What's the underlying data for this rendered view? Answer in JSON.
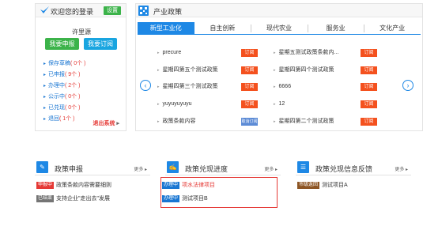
{
  "login": {
    "welcome": "欢迎您的登录",
    "settings": "设置",
    "username": "许里源",
    "subscribe": "我要申报",
    "my_subscribe": "我要订阅",
    "items": [
      {
        "label": "保存草稿",
        "count": "( 0个 )"
      },
      {
        "label": "已申报",
        "count": "( 9个 )"
      },
      {
        "label": "办理中",
        "count": "( 2个 )"
      },
      {
        "label": "公示中",
        "count": "( 0个 )"
      },
      {
        "label": "已兑现",
        "count": "( 0个 )"
      },
      {
        "label": "退回",
        "count": "( 1个 )"
      }
    ],
    "logout": "退出系统"
  },
  "policy": {
    "title": "产业政策",
    "tabs": [
      "新型工业化",
      "自主创新",
      "现代农业",
      "服务业",
      "文化产业"
    ],
    "rows_left": [
      {
        "text": "precure",
        "btn": "订阅"
      },
      {
        "text": "星期四第五个测试政策",
        "btn": "订阅"
      },
      {
        "text": "星期四第三个测试政策",
        "btn": "订阅"
      },
      {
        "text": "yuyuyuyuyu",
        "btn": "订阅"
      },
      {
        "text": "政策条款内容",
        "btn": "取消订阅"
      }
    ],
    "rows_right": [
      {
        "text": "星期五测试政策条款内...",
        "btn": "订阅"
      },
      {
        "text": "星期四第四个测试政策",
        "btn": "订阅"
      },
      {
        "text": "6666",
        "btn": "订阅"
      },
      {
        "text": "12",
        "btn": "订阅"
      },
      {
        "text": "星期四第二个测试政策",
        "btn": "订阅"
      }
    ]
  },
  "declare": {
    "title": "政策申报",
    "more": "更多 ▸",
    "items": [
      {
        "badge": "申报中",
        "text": "政策条款内容需要细则"
      },
      {
        "badge": "已结束",
        "text": "支持企业\"走出去\"发展"
      }
    ]
  },
  "progress": {
    "title": "政策兑现进度",
    "more": "更多 ▸",
    "items": [
      {
        "badge": "办理中",
        "text": "项水法律项目"
      },
      {
        "badge": "办理中",
        "text": "测试项目B"
      }
    ]
  },
  "feedback": {
    "title": "政策兑现信息反馈",
    "more": "更多 ▸",
    "items": [
      {
        "badge": "市级返回",
        "text": "测试项目A"
      }
    ]
  }
}
